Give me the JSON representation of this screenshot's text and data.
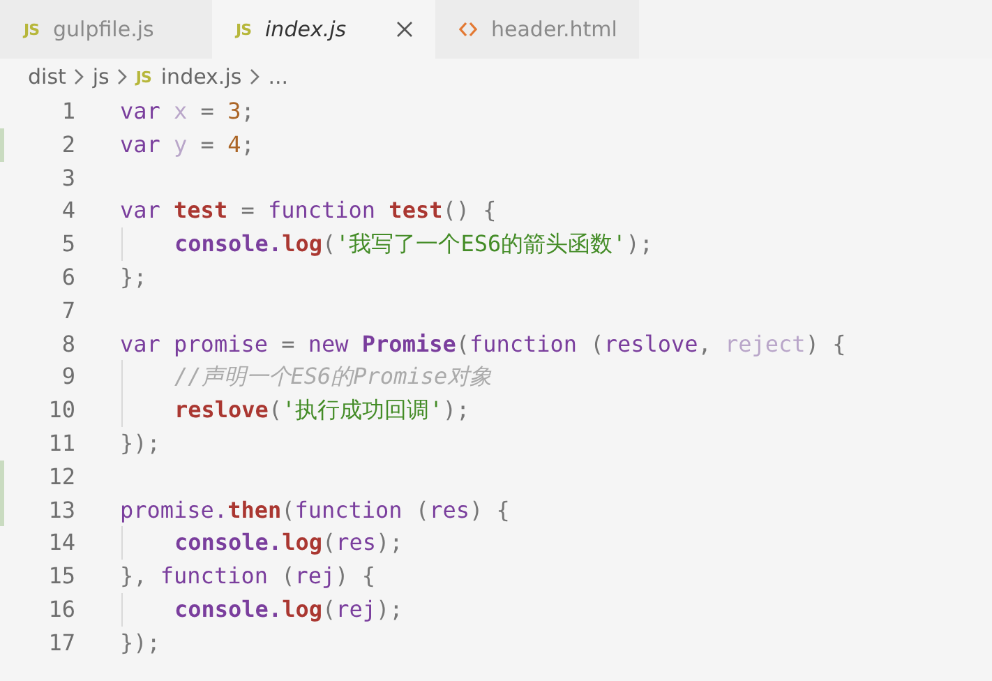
{
  "tabs": [
    {
      "label": "gulpfile.js",
      "kind": "js",
      "badge": "JS",
      "selected": false,
      "preview": false
    },
    {
      "label": "index.js",
      "kind": "js",
      "badge": "JS",
      "selected": true,
      "preview": true
    },
    {
      "label": "header.html",
      "kind": "html",
      "selected": false,
      "preview": false
    }
  ],
  "breadcrumb": [
    {
      "text": "dist"
    },
    {
      "text": "js"
    },
    {
      "text": "index.js",
      "kind": "js",
      "badge": "JS"
    },
    {
      "text": "..."
    }
  ],
  "lines": [
    {
      "number": "1",
      "changed": false,
      "guide": false,
      "tokens": [
        {
          "text": "var",
          "kind": "kw"
        },
        {
          "text": " x",
          "kind": "faded"
        },
        {
          "text": " = ",
          "kind": "p"
        },
        {
          "text": "3",
          "kind": "num"
        },
        {
          "text": ";",
          "kind": "p"
        }
      ]
    },
    {
      "number": "2",
      "changed": true,
      "guide": false,
      "tokens": [
        {
          "text": "var",
          "kind": "kw"
        },
        {
          "text": " y",
          "kind": "faded"
        },
        {
          "text": " = ",
          "kind": "p"
        },
        {
          "text": "4",
          "kind": "num"
        },
        {
          "text": ";",
          "kind": "p"
        }
      ]
    },
    {
      "number": "3",
      "changed": false,
      "guide": false
    },
    {
      "number": "4",
      "changed": false,
      "guide": false,
      "tokens": [
        {
          "text": "var",
          "kind": "kw"
        },
        {
          "text": " test",
          "kind": "fn"
        },
        {
          "text": " = ",
          "kind": "p"
        },
        {
          "text": "function",
          "kind": "kw"
        },
        {
          "text": " test",
          "kind": "fn"
        },
        {
          "text": "() {",
          "kind": "p"
        }
      ]
    },
    {
      "number": "5",
      "changed": false,
      "guide": true,
      "tokens": [
        {
          "text": "console.",
          "kind": "obj"
        },
        {
          "text": "log",
          "kind": "fn"
        },
        {
          "text": "(",
          "kind": "p"
        },
        {
          "text": "'我写了一个ES6的箭头函数'",
          "kind": "str"
        },
        {
          "text": ");",
          "kind": "p"
        }
      ]
    },
    {
      "number": "6",
      "changed": false,
      "guide": false,
      "tokens": [
        {
          "text": "};",
          "kind": "p"
        }
      ]
    },
    {
      "number": "7",
      "changed": false,
      "guide": false
    },
    {
      "number": "8",
      "changed": false,
      "guide": false,
      "tokens": [
        {
          "text": "var",
          "kind": "kw"
        },
        {
          "text": " promise",
          "kind": "id"
        },
        {
          "text": " = ",
          "kind": "p"
        },
        {
          "text": "new",
          "kind": "kw"
        },
        {
          "text": " Promise",
          "kind": "obj"
        },
        {
          "text": "(",
          "kind": "p"
        },
        {
          "text": "function",
          "kind": "kw"
        },
        {
          "text": " (",
          "kind": "p"
        },
        {
          "text": "reslove",
          "kind": "id"
        },
        {
          "text": ", ",
          "kind": "p"
        },
        {
          "text": "reject",
          "kind": "faded"
        },
        {
          "text": ") {",
          "kind": "p"
        }
      ]
    },
    {
      "number": "9",
      "changed": false,
      "guide": true,
      "tokens": [
        {
          "text": "//声明一个ES6的Promise对象",
          "kind": "cmt"
        }
      ]
    },
    {
      "number": "10",
      "changed": false,
      "guide": true,
      "tokens": [
        {
          "text": "reslove",
          "kind": "fn"
        },
        {
          "text": "(",
          "kind": "p"
        },
        {
          "text": "'执行成功回调'",
          "kind": "str"
        },
        {
          "text": ");",
          "kind": "p"
        }
      ]
    },
    {
      "number": "11",
      "changed": false,
      "guide": false,
      "tokens": [
        {
          "text": "});",
          "kind": "p"
        }
      ]
    },
    {
      "number": "12",
      "changed": true,
      "guide": false
    },
    {
      "number": "13",
      "changed": true,
      "guide": false,
      "tokens": [
        {
          "text": "promise.",
          "kind": "id"
        },
        {
          "text": "then",
          "kind": "fn"
        },
        {
          "text": "(",
          "kind": "p"
        },
        {
          "text": "function",
          "kind": "kw"
        },
        {
          "text": " (",
          "kind": "p"
        },
        {
          "text": "res",
          "kind": "id"
        },
        {
          "text": ") {",
          "kind": "p"
        }
      ]
    },
    {
      "number": "14",
      "changed": false,
      "guide": true,
      "tokens": [
        {
          "text": "console.",
          "kind": "obj"
        },
        {
          "text": "log",
          "kind": "fn"
        },
        {
          "text": "(",
          "kind": "p"
        },
        {
          "text": "res",
          "kind": "id"
        },
        {
          "text": ");",
          "kind": "p"
        }
      ]
    },
    {
      "number": "15",
      "changed": false,
      "guide": false,
      "tokens": [
        {
          "text": "}, ",
          "kind": "p"
        },
        {
          "text": "function",
          "kind": "kw"
        },
        {
          "text": " (",
          "kind": "p"
        },
        {
          "text": "rej",
          "kind": "id"
        },
        {
          "text": ") {",
          "kind": "p"
        }
      ]
    },
    {
      "number": "16",
      "changed": false,
      "guide": true,
      "tokens": [
        {
          "text": "console.",
          "kind": "obj"
        },
        {
          "text": "log",
          "kind": "fn"
        },
        {
          "text": "(",
          "kind": "p"
        },
        {
          "text": "rej",
          "kind": "id"
        },
        {
          "text": ");",
          "kind": "p"
        }
      ]
    },
    {
      "number": "17",
      "changed": false,
      "guide": false,
      "tokens": [
        {
          "text": "});",
          "kind": "p"
        }
      ]
    }
  ]
}
